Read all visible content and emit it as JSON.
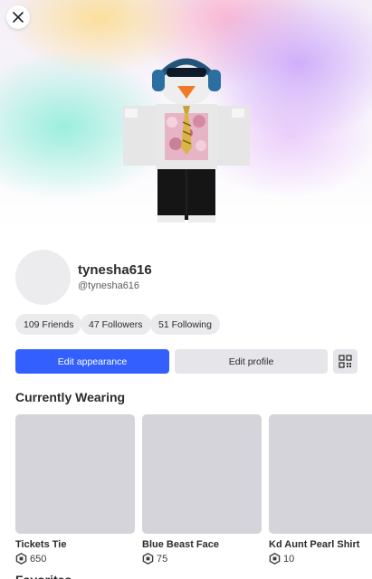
{
  "header": {
    "close_icon": "close-icon"
  },
  "profile": {
    "display_name": "tynesha616",
    "username": "@tynesha616"
  },
  "stats": [
    {
      "label": "109 Friends"
    },
    {
      "label": "47 Followers"
    },
    {
      "label": "51 Following"
    }
  ],
  "actions": {
    "edit_appearance": "Edit appearance",
    "edit_profile": "Edit profile",
    "qr_icon": "qr-code-icon"
  },
  "currently_wearing": {
    "title": "Currently Wearing",
    "items": [
      {
        "name": "Tickets Tie",
        "price": "650"
      },
      {
        "name": "Blue Beast Face",
        "price": "75"
      },
      {
        "name": "Kd Aunt Pearl Shirt",
        "price": "10"
      }
    ]
  },
  "next_section": {
    "title": "Favorites"
  },
  "colors": {
    "primary": "#335fff",
    "pill_bg": "#ebebee",
    "thumb_bg": "#d4d4da"
  }
}
